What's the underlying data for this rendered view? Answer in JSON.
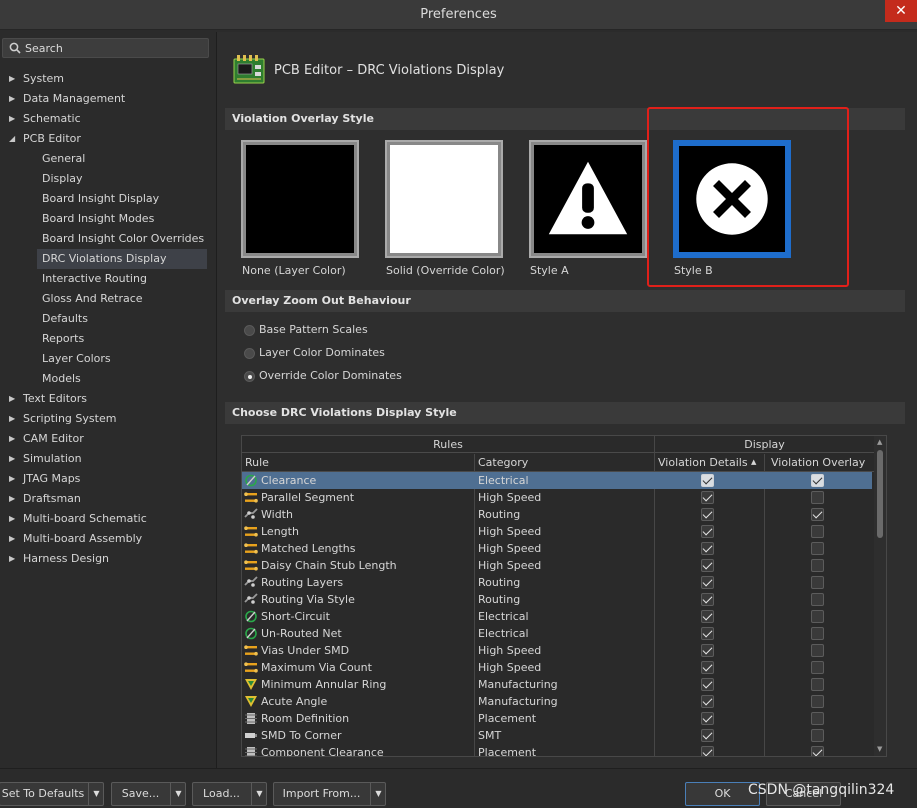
{
  "window": {
    "title": "Preferences",
    "close": "✕"
  },
  "search": {
    "placeholder": "Search"
  },
  "tree": [
    {
      "label": "System",
      "expandable": true
    },
    {
      "label": "Data Management",
      "expandable": true
    },
    {
      "label": "Schematic",
      "expandable": true
    },
    {
      "label": "PCB Editor",
      "expandable": true,
      "expanded": true
    },
    {
      "label": "General",
      "child": true
    },
    {
      "label": "Display",
      "child": true
    },
    {
      "label": "Board Insight Display",
      "child": true
    },
    {
      "label": "Board Insight Modes",
      "child": true
    },
    {
      "label": "Board Insight Color Overrides",
      "child": true
    },
    {
      "label": "DRC Violations Display",
      "child": true,
      "selected": true
    },
    {
      "label": "Interactive Routing",
      "child": true
    },
    {
      "label": "Gloss And Retrace",
      "child": true
    },
    {
      "label": "Defaults",
      "child": true
    },
    {
      "label": "Reports",
      "child": true
    },
    {
      "label": "Layer Colors",
      "child": true
    },
    {
      "label": "Models",
      "child": true
    },
    {
      "label": "Text Editors",
      "expandable": true
    },
    {
      "label": "Scripting System",
      "expandable": true
    },
    {
      "label": "CAM Editor",
      "expandable": true
    },
    {
      "label": "Simulation",
      "expandable": true
    },
    {
      "label": "JTAG Maps",
      "expandable": true
    },
    {
      "label": "Draftsman",
      "expandable": true
    },
    {
      "label": "Multi-board Schematic",
      "expandable": true
    },
    {
      "label": "Multi-board Assembly",
      "expandable": true
    },
    {
      "label": "Harness Design",
      "expandable": true
    }
  ],
  "page": {
    "title": "PCB Editor – DRC Violations Display"
  },
  "overlay_style": {
    "heading": "Violation Overlay Style",
    "options": [
      {
        "label": "None (Layer Color)",
        "kind": "none",
        "selected": false
      },
      {
        "label": "Solid (Override Color)",
        "kind": "solid",
        "selected": false
      },
      {
        "label": "Style A",
        "kind": "style-a",
        "selected": false
      },
      {
        "label": "Style B",
        "kind": "style-b",
        "selected": true
      }
    ]
  },
  "zoom_behaviour": {
    "heading": "Overlay Zoom Out Behaviour",
    "options": [
      {
        "label": "Base Pattern Scales",
        "checked": false
      },
      {
        "label": "Layer Color Dominates",
        "checked": false
      },
      {
        "label": "Override Color Dominates",
        "checked": true
      }
    ]
  },
  "drc_style": {
    "heading": "Choose DRC Violations Display Style",
    "group_headers": {
      "rules": "Rules",
      "display": "Display"
    },
    "columns": {
      "rule": "Rule",
      "category": "Category",
      "details": "Violation Details",
      "overlay": "Violation Overlay",
      "sort_indicator": "▲"
    },
    "rows": [
      {
        "rule": "Clearance",
        "category": "Electrical",
        "icon": "electrical",
        "details": true,
        "overlay": true,
        "selected": true
      },
      {
        "rule": "Parallel Segment",
        "category": "High Speed",
        "icon": "highspeed",
        "details": true,
        "overlay": false
      },
      {
        "rule": "Width",
        "category": "Routing",
        "icon": "routing",
        "details": true,
        "overlay": true
      },
      {
        "rule": "Length",
        "category": "High Speed",
        "icon": "highspeed",
        "details": true,
        "overlay": false
      },
      {
        "rule": "Matched Lengths",
        "category": "High Speed",
        "icon": "highspeed",
        "details": true,
        "overlay": false
      },
      {
        "rule": "Daisy Chain Stub Length",
        "category": "High Speed",
        "icon": "highspeed",
        "details": true,
        "overlay": false
      },
      {
        "rule": "Routing Layers",
        "category": "Routing",
        "icon": "routing",
        "details": true,
        "overlay": false
      },
      {
        "rule": "Routing Via Style",
        "category": "Routing",
        "icon": "routing",
        "details": true,
        "overlay": false
      },
      {
        "rule": "Short-Circuit",
        "category": "Electrical",
        "icon": "electrical",
        "details": true,
        "overlay": false
      },
      {
        "rule": "Un-Routed Net",
        "category": "Electrical",
        "icon": "electrical",
        "details": true,
        "overlay": false
      },
      {
        "rule": "Vias Under SMD",
        "category": "High Speed",
        "icon": "highspeed",
        "details": true,
        "overlay": false
      },
      {
        "rule": "Maximum Via Count",
        "category": "High Speed",
        "icon": "highspeed",
        "details": true,
        "overlay": false
      },
      {
        "rule": "Minimum Annular Ring",
        "category": "Manufacturing",
        "icon": "manufacturing",
        "details": true,
        "overlay": false
      },
      {
        "rule": "Acute Angle",
        "category": "Manufacturing",
        "icon": "manufacturing",
        "details": true,
        "overlay": false
      },
      {
        "rule": "Room Definition",
        "category": "Placement",
        "icon": "placement",
        "details": true,
        "overlay": false
      },
      {
        "rule": "SMD To Corner",
        "category": "SMT",
        "icon": "smt",
        "details": true,
        "overlay": false
      },
      {
        "rule": "Component Clearance",
        "category": "Placement",
        "icon": "placement",
        "details": true,
        "overlay": true
      }
    ]
  },
  "buttons": {
    "defaults": "Set To Defaults",
    "save": "Save...",
    "load": "Load...",
    "import": "Import From...",
    "ok": "OK",
    "cancel": "Cancel",
    "dropdown": "▼"
  },
  "watermark": "CSDN @tangqilin324",
  "colors": {
    "accent": "#1e6dcc",
    "highlight": "#e0201a",
    "selected_row": "#4f6f92"
  }
}
